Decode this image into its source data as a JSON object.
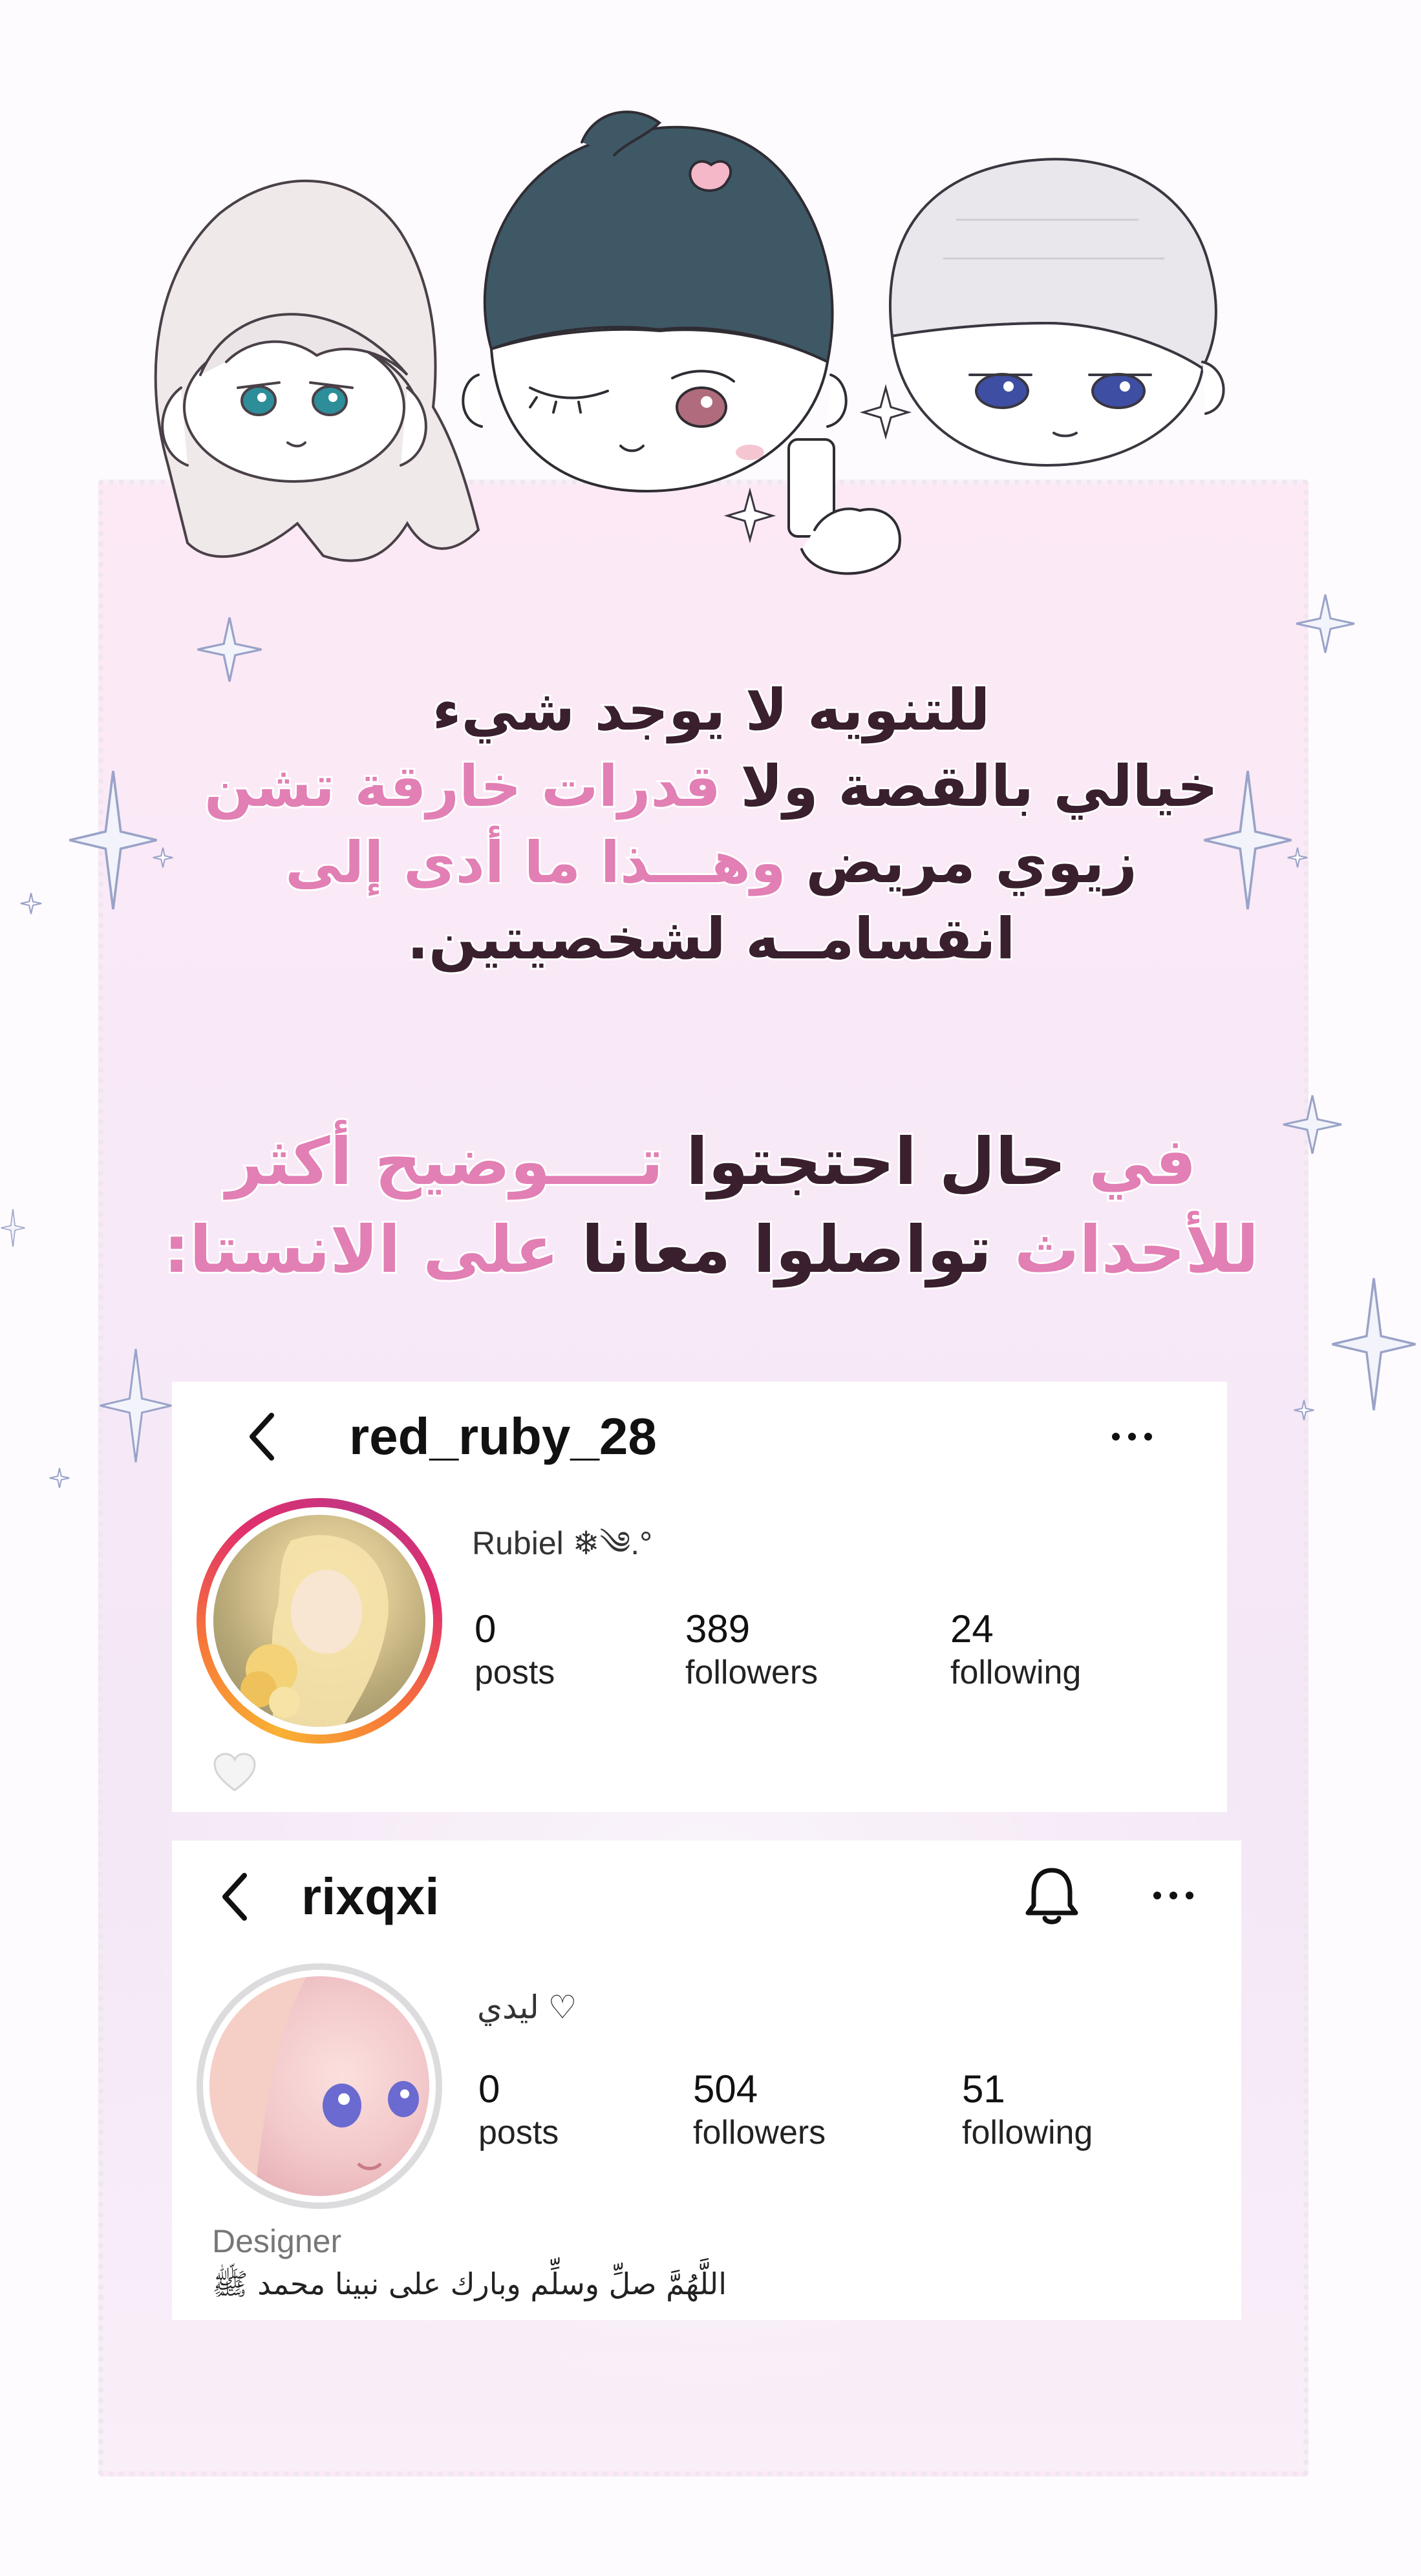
{
  "intro_text": {
    "line1": "للتنويه لا يوجد شيء",
    "line2_dark": "خيالي بالقصة ولا ",
    "line2_pink": "قدرات خارقة تشن",
    "line3_dark": "زيوي مريض ",
    "line3_pink": "وهـــذا ما أدى إلى",
    "line4": "انقسامــه لشخصيتين."
  },
  "contact_text": {
    "line1_pink_a": "في ",
    "line1_dark": "حال احتجتوا ",
    "line1_pink_b": "تــــوضيح أكثر",
    "line2_pink_a": "للأحداث ",
    "line2_dark": "تواصلوا معانا ",
    "line2_pink_b": "على الانستا:"
  },
  "profile1": {
    "username": "red_ruby_28",
    "display_name": "Rubiel ❄༄.°",
    "posts_count": "0",
    "posts_label": "posts",
    "followers_count": "389",
    "followers_label": "followers",
    "following_count": "24",
    "following_label": "following",
    "back_icon": "chevron-left-icon",
    "more_icon": "more-icon",
    "highlight_icon": "heart-icon"
  },
  "profile2": {
    "username": "rixqxi",
    "display_name": "♡ ليدي",
    "posts_count": "0",
    "posts_label": "posts",
    "followers_count": "504",
    "followers_label": "followers",
    "following_count": "51",
    "following_label": "following",
    "category": "Designer",
    "bio": "اللَّهُمَّ صلِّ وسلِّم وبارك على نبينا محمد ﷺ",
    "back_icon": "chevron-left-icon",
    "bell_icon": "bell-icon",
    "more_icon": "more-icon"
  },
  "colors": {
    "pink_text": "#e27fb4",
    "dark_text": "#3a1f2e",
    "panel_bg": "#f7e9f7",
    "story_ring_start": "#f9b233",
    "story_ring_mid": "#e1306c",
    "story_ring_end": "#c13584"
  }
}
